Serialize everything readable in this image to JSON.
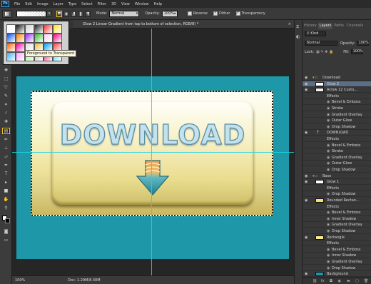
{
  "app": {
    "logo": "Ps"
  },
  "menu": [
    "File",
    "Edit",
    "Image",
    "Layer",
    "Type",
    "Select",
    "Filter",
    "3D",
    "View",
    "Window",
    "Help"
  ],
  "options": {
    "mode_label": "Mode:",
    "mode_value": "Normal",
    "opacity_label": "Opacity:",
    "opacity_value": "100%",
    "reverse_label": "Reverse",
    "dither_label": "Dither",
    "transparency_label": "Transparency",
    "reverse_checked": false,
    "dither_checked": true,
    "transparency_checked": true
  },
  "gradient_picker": {
    "tooltip": "Foreground to Transparent",
    "swatches": [
      "#ffffff",
      "#111111",
      "#d0d0d0",
      "#222222",
      "#ff3030",
      "#ffe020",
      "#0050ff",
      "#ff8000",
      "#a030ff",
      "#30c030",
      "#ffd0f0",
      "#ff0080",
      "#ff6000",
      "#ff00a0",
      "#e0e0e0",
      "#e8c040",
      "#00a0ff",
      "#ff4040",
      "#30b0ff",
      "#ffa0ff",
      "#80ff80",
      "#c0c0c0",
      "#ff2080",
      "#40e0ff"
    ]
  },
  "document": {
    "tab_title": "Glow 2       Linear Gradient from top to bottom of selection, RGB/8) *",
    "close": "×",
    "headline": "DOWNLOAD"
  },
  "status": {
    "zoom": "100%",
    "doc": "Doc: 1.29M/8.30M"
  },
  "layers_panel": {
    "tabs": [
      "History",
      "Layers",
      "Paths",
      "Channels"
    ],
    "kind_label": "Kind",
    "blend_mode": "Normal",
    "opacity_label": "Opacity:",
    "opacity_value": "100%",
    "lock_label": "Lock:",
    "fill_label": "Fill:",
    "fill_value": "100%",
    "layers": [
      {
        "name": "Download",
        "kind": "group"
      },
      {
        "name": "Glow 2",
        "kind": "layer",
        "selected": true
      },
      {
        "name": "Arrow 12 Custo...",
        "kind": "layer"
      },
      {
        "name": "Effects",
        "kind": "fx"
      },
      {
        "name": "Bevel & Emboss",
        "kind": "effect"
      },
      {
        "name": "Stroke",
        "kind": "effect"
      },
      {
        "name": "Gradient Overlay",
        "kind": "effect"
      },
      {
        "name": "Outer Glow",
        "kind": "effect"
      },
      {
        "name": "Drop Shadow",
        "kind": "effect"
      },
      {
        "name": "DOWNLOAD",
        "kind": "text"
      },
      {
        "name": "Effects",
        "kind": "fx"
      },
      {
        "name": "Bevel & Emboss",
        "kind": "effect"
      },
      {
        "name": "Stroke",
        "kind": "effect"
      },
      {
        "name": "Gradient Overlay",
        "kind": "effect"
      },
      {
        "name": "Outer Glow",
        "kind": "effect"
      },
      {
        "name": "Drop Shadow",
        "kind": "effect"
      },
      {
        "name": "Base",
        "kind": "group"
      },
      {
        "name": "Glow 1",
        "kind": "layer"
      },
      {
        "name": "Effects",
        "kind": "fx"
      },
      {
        "name": "Drop Shadow",
        "kind": "effect"
      },
      {
        "name": "Rounded Rectan...",
        "kind": "layer"
      },
      {
        "name": "Effects",
        "kind": "fx"
      },
      {
        "name": "Bevel & Emboss",
        "kind": "effect"
      },
      {
        "name": "Inner Shadow",
        "kind": "effect"
      },
      {
        "name": "Gradient Overlay",
        "kind": "effect"
      },
      {
        "name": "Drop Shadow",
        "kind": "effect"
      },
      {
        "name": "Rectangle",
        "kind": "layer"
      },
      {
        "name": "Effects",
        "kind": "fx"
      },
      {
        "name": "Bevel & Emboss",
        "kind": "effect"
      },
      {
        "name": "Inner Shadow",
        "kind": "effect"
      },
      {
        "name": "Gradient Overlay",
        "kind": "effect"
      },
      {
        "name": "Drop Shadow",
        "kind": "effect"
      },
      {
        "name": "Background",
        "kind": "layer"
      }
    ]
  }
}
